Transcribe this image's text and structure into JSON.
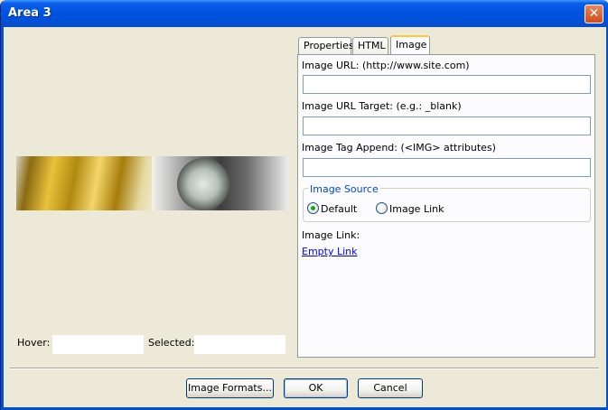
{
  "window": {
    "title": "Area 3",
    "close_icon": "close-icon"
  },
  "preview": {
    "hover_label": "Hover:",
    "hover_value": "",
    "selected_label": "Selected:",
    "selected_value": ""
  },
  "tabs": [
    {
      "label": "Properties",
      "active": false
    },
    {
      "label": "HTML",
      "active": false
    },
    {
      "label": "Image",
      "active": true
    }
  ],
  "image_tab": {
    "url_label": "Image URL: (http://www.site.com)",
    "url_value": "",
    "target_label": "Image URL Target: (e.g.: _blank)",
    "target_value": "",
    "append_label": "Image Tag Append: (<IMG> attributes)",
    "append_value": "",
    "source_group_title": "Image Source",
    "source_options": [
      {
        "label": "Default",
        "selected": true
      },
      {
        "label": "Image Link",
        "selected": false
      }
    ],
    "image_link_label": "Image Link:",
    "image_link_value": "Empty Link"
  },
  "buttons": {
    "image_formats": "Image Formats...",
    "ok": "OK",
    "cancel": "Cancel"
  },
  "colors": {
    "titlebar": "#0053e1",
    "dialog_bg": "#ece9d8",
    "active_tab_accent": "#ffc83c",
    "link": "#0000ff",
    "group_title": "#0046d5"
  }
}
